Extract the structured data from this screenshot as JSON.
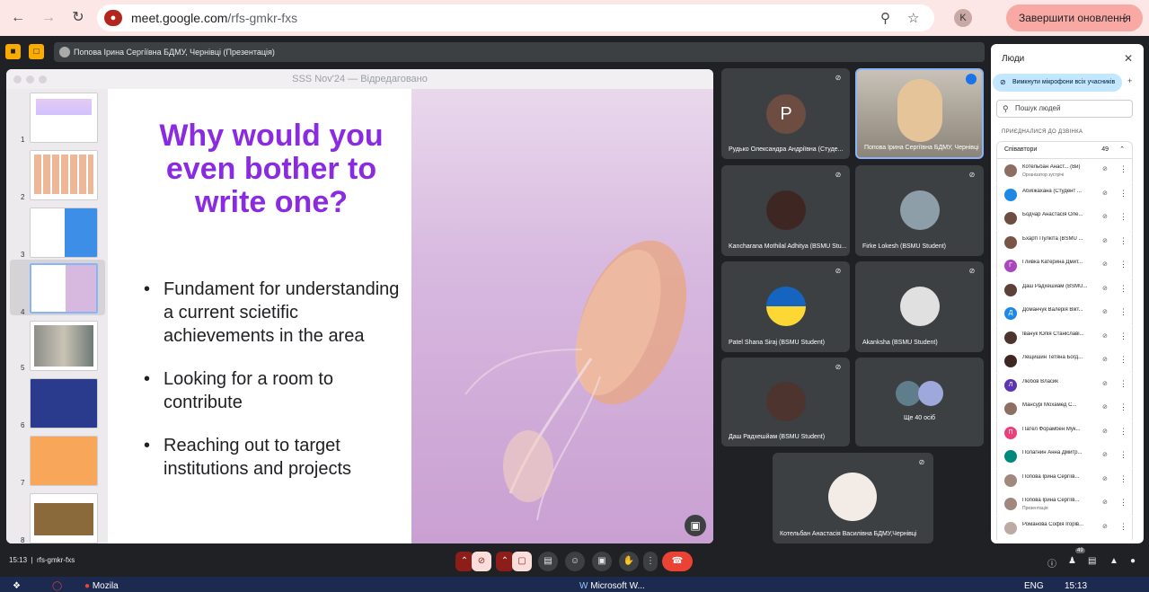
{
  "browser": {
    "url_host": "meet.google.com",
    "url_path": "/rfs-gmkr-fxs",
    "profile_initial": "K",
    "update_button": "Завершити оновлення"
  },
  "meet": {
    "presenter_chip": "Попова Ірина Сергіївна БДМУ, Чернівці (Презентація)",
    "keynote_title": "SSS Nov'24 — Відредаговано",
    "slide": {
      "title": "Why would you even bother to write one?",
      "bullets": [
        "Fundament for understanding a current scietific achievements in the area",
        "Looking for a room to contribute",
        "Reaching out to target institutions and projects"
      ]
    },
    "thumbnails": [
      "1",
      "2",
      "3",
      "4",
      "5",
      "6",
      "7",
      "8"
    ],
    "tiles": [
      {
        "name": "Рудько Олександра Андріївна (Студе...",
        "initial": "P"
      },
      {
        "name": "Попова Ірина Сергіївна БДМУ, Чернівці"
      },
      {
        "name": "Kancharana Mothilal Adhitya (BSMU Stu..."
      },
      {
        "name": "Firke Lokesh (BSMU Student)"
      },
      {
        "name": "Patel Shana Siraj (BSMU Student)"
      },
      {
        "name": "Akanksha (BSMU Student)"
      },
      {
        "name": "Даш Радхешйам (BSMU Student)"
      },
      {
        "name": "Ще 40 осіб"
      },
      {
        "name": "Котельбан Анастасія Василівна БДМУ,Чернівці"
      }
    ],
    "people": {
      "title": "Люди",
      "mute_all": "Вимкнути мікрофони всіх учасників",
      "search_placeholder": "Пошук людей",
      "section": "ПРИЄДНАЛИСЯ ДО ДЗВІНКА",
      "group": "Співавтори",
      "count": "49",
      "list": [
        {
          "name": "Котельбан Анаст...  (Ви)",
          "sub": "Організатор зустрічі",
          "color": "#8d6e63"
        },
        {
          "name": "Абиїжахана (Студент ...",
          "sub": "",
          "color": "#1e88e5"
        },
        {
          "name": "Бодчар Анастасія Оле...",
          "sub": "",
          "color": "#6d4c41"
        },
        {
          "name": "Бхарті Пулкіта (BSMU ...",
          "sub": "",
          "color": "#795548"
        },
        {
          "name": "Гливка Катерина Дмит...",
          "sub": "",
          "color": "#ab47bc",
          "initial": "Г"
        },
        {
          "name": "Даш Радхешйам (BSMU...",
          "sub": "",
          "color": "#5d4037"
        },
        {
          "name": "Доманчук Валерія Вікт...",
          "sub": "",
          "color": "#1e88e5",
          "initial": "Д"
        },
        {
          "name": "Іванук Юлія Станіславі...",
          "sub": "",
          "color": "#4e342e"
        },
        {
          "name": "Лещишин Тетяна Богд...",
          "sub": "",
          "color": "#3e2723"
        },
        {
          "name": "Любов Власик",
          "sub": "",
          "color": "#5e35b1",
          "initial": "Л"
        },
        {
          "name": "Мансурі Мохамед С...",
          "sub": "",
          "color": "#8d6e63"
        },
        {
          "name": "Пател Форамбен Мук...",
          "sub": "",
          "color": "#ec407a",
          "initial": "П"
        },
        {
          "name": "Полагнин Анна Дмитр...",
          "sub": "",
          "color": "#00897b"
        },
        {
          "name": "Попова Ірина Сергіїв...",
          "sub": "",
          "color": "#a1887f"
        },
        {
          "name": "Попова Ірина Сергіїв...",
          "sub": "Презентація",
          "color": "#a1887f"
        },
        {
          "name": "Романова Софія Ігорів...",
          "sub": "",
          "color": "#bcaaa4"
        }
      ]
    },
    "bottom": {
      "time": "15:13",
      "code": "rfs-gmkr-fxs",
      "people_count": "49"
    }
  },
  "taskbar": {
    "time": "15:13",
    "lang": "ENG",
    "items": [
      "Mozila",
      "Microsoft W..."
    ]
  }
}
